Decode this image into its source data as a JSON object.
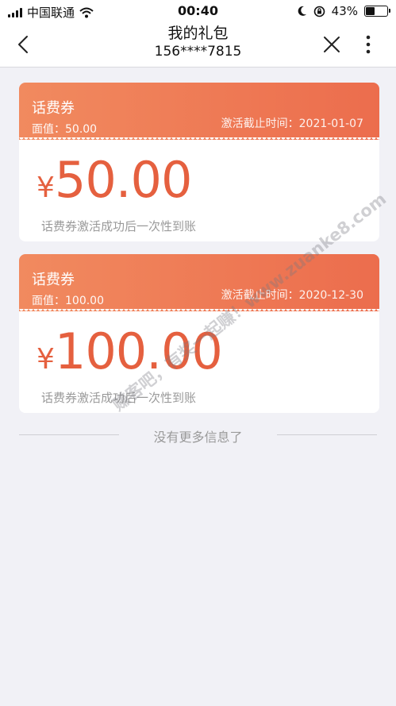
{
  "status_bar": {
    "carrier": "中国联通",
    "time": "00:40",
    "battery_percent": "43%",
    "battery_level": 0.43
  },
  "nav": {
    "title": "我的礼包",
    "subtitle": "156****7815"
  },
  "coupons": [
    {
      "name": "话费券",
      "face_value": "面值：50.00",
      "expire": "激活截止时间：2021-01-07",
      "currency": "¥",
      "amount": "50.00",
      "description": "话费券激活成功后一次性到账"
    },
    {
      "name": "话费券",
      "face_value": "面值：100.00",
      "expire": "激活截止时间：2020-12-30",
      "currency": "¥",
      "amount": "100.00",
      "description": "话费券激活成功后一次性到账"
    }
  ],
  "footer": {
    "no_more": "没有更多信息了"
  },
  "watermark": {
    "text": "赚客吧，有奖一起赚！www.zuanke8.com"
  },
  "colors": {
    "accent": "#ec6d4d",
    "amount": "#e5603f",
    "background": "#f1f1f6"
  }
}
